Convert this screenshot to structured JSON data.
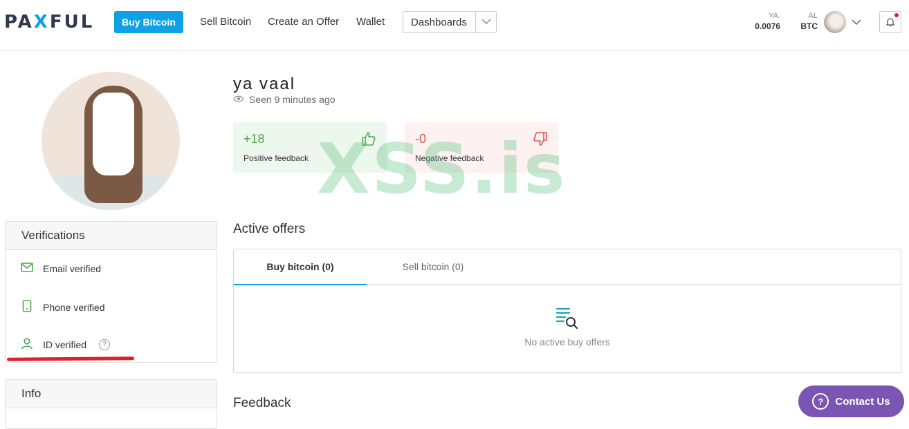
{
  "colors": {
    "brand": "#0fa0e6",
    "positive": "#4aa74e",
    "negative": "#d9534f",
    "contact": "#7a55b3"
  },
  "header": {
    "logo": {
      "pre": "PA",
      "x": "X",
      "post": "FUL"
    },
    "buy_bitcoin": "Buy Bitcoin",
    "nav": [
      "Sell Bitcoin",
      "Create an Offer",
      "Wallet"
    ],
    "dashboards": "Dashboards",
    "balance1": {
      "label": "YA.",
      "value": "0.0076"
    },
    "balance2": {
      "label": "AL",
      "value": "BTC"
    }
  },
  "profile": {
    "username": "ya  vaal",
    "seen": "Seen 9 minutes ago",
    "positive": {
      "value": "+18",
      "label": "Positive feedback"
    },
    "negative": {
      "value": "-0",
      "label": "Negative feedback"
    }
  },
  "watermark": "XSS.is",
  "verifications": {
    "title": "Verifications",
    "items": [
      "Email verified",
      "Phone verified",
      "ID verified"
    ],
    "help_mark": "?"
  },
  "info": {
    "title": "Info"
  },
  "offers": {
    "title": "Active offers",
    "tabs": [
      "Buy bitcoin (0)",
      "Sell bitcoin (0)"
    ],
    "empty": "No active buy offers"
  },
  "feedback": {
    "title": "Feedback"
  },
  "contact": {
    "label": "Contact Us",
    "icon": "?"
  },
  "icons": [
    "eye-icon",
    "thumbs-up-icon",
    "thumbs-down-icon",
    "envelope-icon",
    "phone-icon",
    "user-icon",
    "help-icon",
    "list-search-icon",
    "bell-icon",
    "chevron-down-icon"
  ]
}
